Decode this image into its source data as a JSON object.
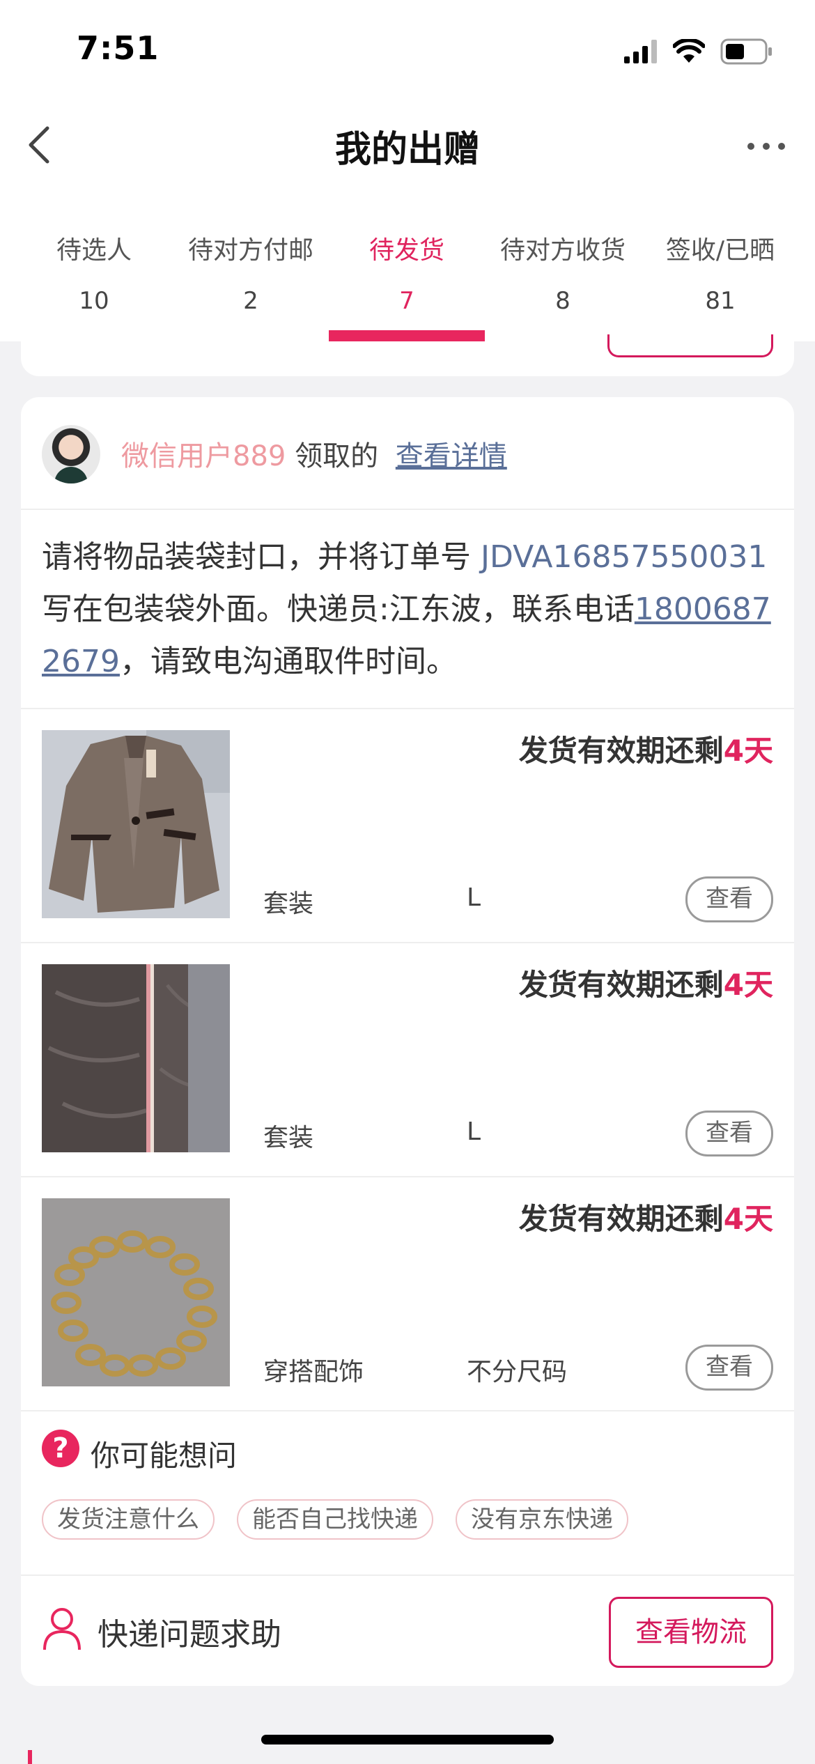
{
  "status_bar": {
    "time": "7:51"
  },
  "header": {
    "title": "我的出赠"
  },
  "tabs": [
    {
      "label": "待选人",
      "count": "10",
      "active": false
    },
    {
      "label": "待对方付邮",
      "count": "2",
      "active": false
    },
    {
      "label": "待发货",
      "count": "7",
      "active": true
    },
    {
      "label": "待对方收货",
      "count": "8",
      "active": false
    },
    {
      "label": "签收/已晒",
      "count": "81",
      "active": false
    }
  ],
  "order": {
    "recipient_name": "微信用户889",
    "received_text": "领取的",
    "detail_link": "查看详情",
    "instruction": {
      "pre": "请将物品装袋封口，并将订单号 ",
      "order_no": "JDVA16857550031",
      "mid": " 写在包装袋外面。快递员:江东波，联系电话",
      "phone": "18006872679",
      "post": "，请致电沟通取件时间。"
    },
    "items": [
      {
        "deadline_prefix": "发货有效期还剩",
        "deadline_days": "4天",
        "category": "套装",
        "size": "L",
        "view_label": "查看",
        "image": "jacket-photo"
      },
      {
        "deadline_prefix": "发货有效期还剩",
        "deadline_days": "4天",
        "category": "套装",
        "size": "L",
        "view_label": "查看",
        "image": "fabric-measure-photo"
      },
      {
        "deadline_prefix": "发货有效期还剩",
        "deadline_days": "4天",
        "category": "穿搭配饰",
        "size": "不分尺码",
        "view_label": "查看",
        "image": "chain-necklace-photo"
      }
    ],
    "faq": {
      "title": "你可能想问",
      "chips": [
        "发货注意什么",
        "能否自己找快递",
        "没有京东快递"
      ]
    },
    "help": {
      "label": "快递问题求助",
      "button": "查看物流"
    }
  },
  "colors": {
    "accent": "#e0245e",
    "link": "#5a6f98",
    "recipient": "#ee9aa0"
  }
}
